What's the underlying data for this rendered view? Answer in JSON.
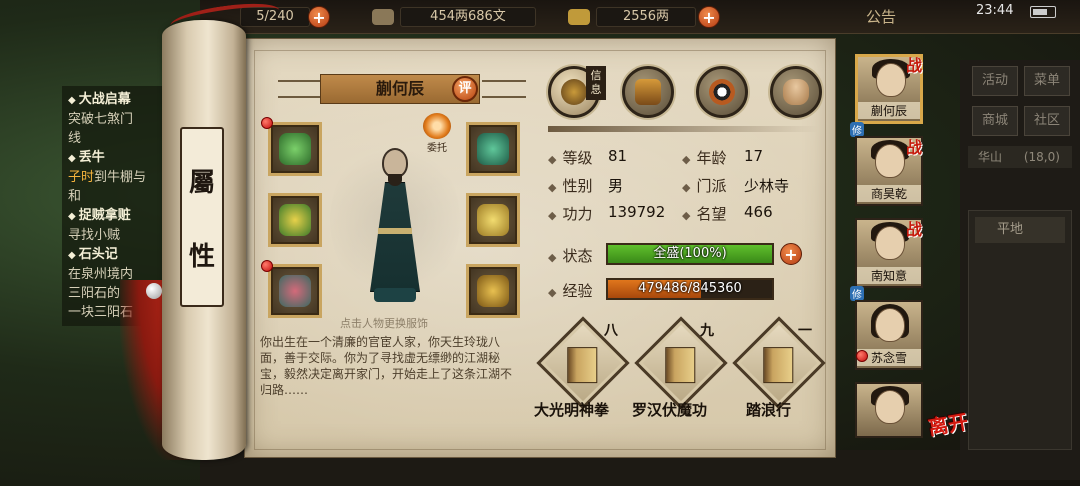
{
  "topbar": {
    "energy": "5/240",
    "money": "454两686文",
    "gold": "2556两",
    "notice": "公告",
    "clock": "23:44"
  },
  "quests": [
    {
      "title": "大战启幕",
      "desc": [
        "突破七煞门",
        "线"
      ]
    },
    {
      "title": "丢牛",
      "desc_hl": "子时",
      "desc": [
        "到牛棚与",
        "和"
      ]
    },
    {
      "title": "捉贼拿赃",
      "desc": [
        "寻找小贼"
      ]
    },
    {
      "title": "石头记",
      "desc": [
        "在泉州境内",
        "三阳石的",
        "一块三阳石"
      ]
    }
  ],
  "side_menu": {
    "buttons": [
      "活动",
      "菜单",
      "商城",
      "社区"
    ],
    "region": "华山",
    "region_extra": "(18,0)",
    "terrain": "平地"
  },
  "scroll": {
    "title_chars": [
      "屬",
      "性"
    ]
  },
  "character": {
    "name": "蒯何辰",
    "rate_label": "评",
    "delegate_label": "委托",
    "change_hint": "点击人物更换服饰",
    "bio": "你出生在一个清廉的官宦人家，你天生玲珑八面，善于交际。你为了寻找虚无缥缈的江湖秘宝，毅然决定离开家门，开始走上了这条江湖不归路……"
  },
  "tabs": [
    {
      "name": "info",
      "label": "信息",
      "active": true
    },
    {
      "name": "equipment",
      "active": false
    },
    {
      "name": "bagua",
      "active": false
    },
    {
      "name": "meridian",
      "active": false
    }
  ],
  "stats": {
    "level_label": "等级",
    "level": "81",
    "age_label": "年龄",
    "age": "17",
    "gender_label": "性别",
    "gender": "男",
    "sect_label": "门派",
    "sect": "少林寺",
    "power_label": "功力",
    "power": "139792",
    "fame_label": "名望",
    "fame": "466",
    "state_label": "状态",
    "state_text": "全盛(100%)",
    "state_fraction": 1.0,
    "exp_label": "经验",
    "exp_text": "479486/845360",
    "exp_fraction": 0.567
  },
  "skills": [
    {
      "name": "大光明神拳",
      "rank": "八"
    },
    {
      "name": "罗汉伏魔功",
      "rank": "九"
    },
    {
      "name": "踏浪行",
      "rank": "一"
    }
  ],
  "party": [
    {
      "name": "蒯何辰",
      "battle": "战",
      "rep": "修",
      "selected": true
    },
    {
      "name": "商昊乾",
      "battle": "战",
      "rep": "",
      "selected": false
    },
    {
      "name": "南知意",
      "battle": "战",
      "rep": "修",
      "selected": false
    },
    {
      "name": "苏念雪",
      "battle": "",
      "rep": "",
      "selected": false
    },
    {
      "name": "",
      "battle": "",
      "rep": "",
      "selected": false
    }
  ],
  "leave_label": "离开",
  "colors": {
    "state_fill": "#5fbf2c",
    "exp_fill": "#e0761c",
    "badge_red": "#c40e0e"
  }
}
